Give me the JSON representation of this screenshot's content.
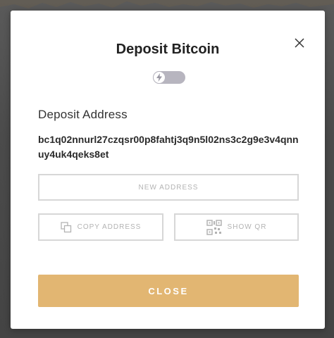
{
  "modal": {
    "title": "Deposit Bitcoin",
    "close_icon": "close-icon",
    "toggle": {
      "icon": "lightning-icon",
      "state": "off"
    },
    "deposit_address_label": "Deposit Address",
    "deposit_address_value": "bc1q02nnurl27czqsr00p8fahtj3q9n5l02ns3c2g9e3v4qnnuy4uk4qeks8et",
    "buttons": {
      "new_address": "NEW ADDRESS",
      "copy_address": "COPY ADDRESS",
      "copy_icon": "copy-icon",
      "show_qr": "SHOW QR",
      "qr_icon": "qr-code-icon",
      "close": "CLOSE"
    }
  },
  "colors": {
    "accent": "#e2b672",
    "toggle": "#b7b5bf",
    "border": "#d7d7d7",
    "muted_text": "#b3b3b3",
    "overlay": "#4a4a4a"
  }
}
